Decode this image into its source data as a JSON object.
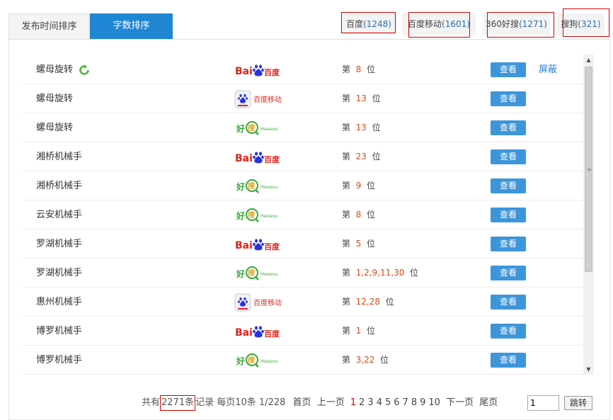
{
  "tabs": [
    {
      "label": "发布时间排序",
      "active": false
    },
    {
      "label": "字数排序",
      "active": true
    }
  ],
  "engines": [
    {
      "name": "百度",
      "count": "(1248)"
    },
    {
      "name": "百度移动",
      "count": "(1601)"
    },
    {
      "name": "360好搜",
      "count": "(1271)"
    },
    {
      "name": "搜狗",
      "count": "(321)"
    }
  ],
  "rows": [
    {
      "keyword": "螺母旋转",
      "engine": "baidu",
      "rank_prefix": "第",
      "rank": "8",
      "rank_suffix": "位",
      "view_label": "查看",
      "block_label": "屏蔽"
    },
    {
      "keyword": "螺母旋转",
      "engine": "baidu-mobile",
      "rank_prefix": "第",
      "rank": "13",
      "rank_suffix": "位",
      "view_label": "查看"
    },
    {
      "keyword": "螺母旋转",
      "engine": "haosou",
      "rank_prefix": "第",
      "rank": "13",
      "rank_suffix": "位",
      "view_label": "查看"
    },
    {
      "keyword": "湘桥机械手",
      "engine": "baidu",
      "rank_prefix": "第",
      "rank": "23",
      "rank_suffix": "位",
      "view_label": "查看"
    },
    {
      "keyword": "湘桥机械手",
      "engine": "haosou",
      "rank_prefix": "第",
      "rank": "9",
      "rank_suffix": "位",
      "view_label": "查看"
    },
    {
      "keyword": "云安机械手",
      "engine": "haosou",
      "rank_prefix": "第",
      "rank": "8",
      "rank_suffix": "位",
      "view_label": "查看"
    },
    {
      "keyword": "罗湖机械手",
      "engine": "baidu",
      "rank_prefix": "第",
      "rank": "5",
      "rank_suffix": "位",
      "view_label": "查看"
    },
    {
      "keyword": "罗湖机械手",
      "engine": "haosou",
      "rank_prefix": "第",
      "rank": "1,2,9,11,30",
      "rank_suffix": "位",
      "view_label": "查看"
    },
    {
      "keyword": "惠州机械手",
      "engine": "baidu-mobile",
      "rank_prefix": "第",
      "rank": "12,28",
      "rank_suffix": "位",
      "view_label": "查看"
    },
    {
      "keyword": "博罗机械手",
      "engine": "baidu",
      "rank_prefix": "第",
      "rank": "1",
      "rank_suffix": "位",
      "view_label": "查看"
    },
    {
      "keyword": "博罗机械手",
      "engine": "haosou",
      "rank_prefix": "第",
      "rank": "3,22",
      "rank_suffix": "位",
      "view_label": "查看"
    }
  ],
  "logos": {
    "baidu_text_left": "Bai",
    "baidu_text_right": "百度",
    "baidu_mobile_text": "百度移动",
    "haosou_char1": "好",
    "haosou_char2": "搜",
    "haosou_text": "Haosou"
  },
  "pagination": {
    "prefix": "共有",
    "total": "2271条",
    "suffix": "记录 每页10条 1/228",
    "first": "首页",
    "prev": "上一页",
    "pages": [
      "1",
      "2",
      "3",
      "4",
      "5",
      "6",
      "7",
      "8",
      "9",
      "10"
    ],
    "current": "1",
    "next": "下一页",
    "last": "尾页",
    "jump_value": "1",
    "jump_label": "跳转"
  },
  "colors": {
    "tab_active": "#1f86d3",
    "button": "#3d95da",
    "rank_number": "#e04a14",
    "highlight_border": "#d40000"
  }
}
